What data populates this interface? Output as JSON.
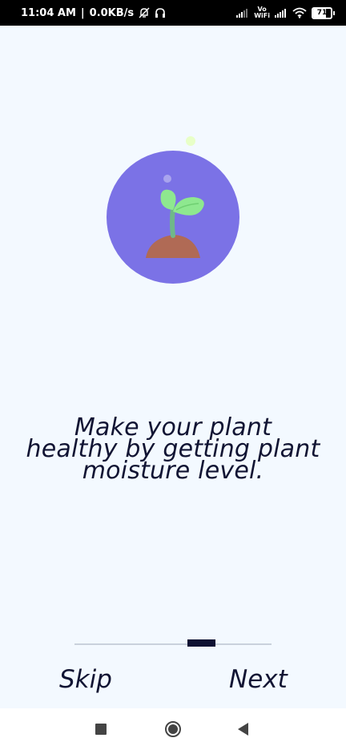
{
  "status_bar": {
    "time": "11:04 AM",
    "network_speed": "0.0KB/s",
    "icons": [
      "mute-icon",
      "headphones-icon",
      "signal-icon",
      "signal-icon",
      "wifi-icon",
      "battery-icon"
    ],
    "volte_label_top": "Vo",
    "volte_label_bottom": "WiFi",
    "battery_level": "71"
  },
  "illustration": {
    "icon": "plant-sprout-icon",
    "circle_color": "#7b72e6",
    "soil_color": "#b06a55",
    "leaf_color": "#8ee88f",
    "stem_color": "#6fb889"
  },
  "onboarding": {
    "message_line1": "Make your plant",
    "message_line2": "healthy by getting plant",
    "message_line3": "moisture level.",
    "progress_fraction": 0.6
  },
  "actions": {
    "skip_label": "Skip",
    "next_label": "Next"
  },
  "nav": {
    "icons": [
      "recents-icon",
      "home-icon",
      "back-icon"
    ]
  },
  "colors": {
    "background": "#f3f9ff",
    "text": "#111433",
    "indicator_active": "#0f1233",
    "indicator_track": "#c9d1dc"
  }
}
